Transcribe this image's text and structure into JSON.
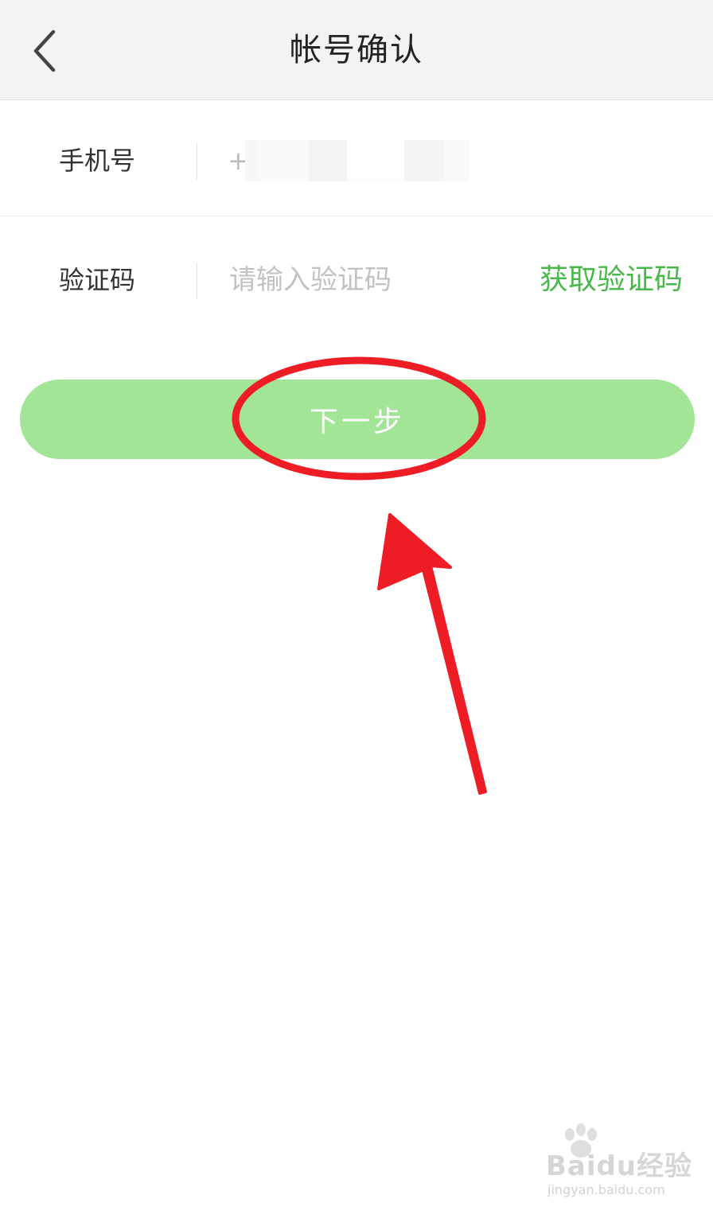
{
  "header": {
    "title": "帐号确认",
    "back_icon": "chevron-left-icon"
  },
  "form": {
    "phone": {
      "label": "手机号",
      "prefix": "+"
    },
    "code": {
      "label": "验证码",
      "placeholder": "请输入验证码",
      "get_code_label": "获取验证码"
    },
    "next_label": "下一步"
  },
  "colors": {
    "accent": "#49b84a",
    "button": "#a2e596",
    "annotation": "#ee1c25"
  },
  "watermark": {
    "brand": "Baidu经验",
    "url": "jingyan.baidu.com"
  }
}
